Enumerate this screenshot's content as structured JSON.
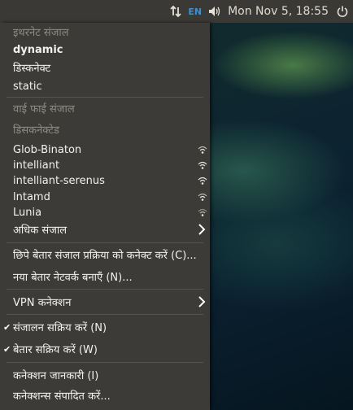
{
  "topbar": {
    "lang": "EN",
    "clock": "Mon Nov  5, 18:55"
  },
  "menu": {
    "ethernet_header": "इथरनेट संजाल",
    "ethernet_items": [
      "dynamic",
      "डिस्कनेक्ट",
      "static"
    ],
    "wifi_header": "वाई फाई  संजाल",
    "wifi_disconnected": "डिसकनेक्टेड",
    "networks": [
      "Glob-Binaton",
      "intelliant",
      "intelliant-serenus",
      "lntamd",
      "Lunia"
    ],
    "more_networks": "अधिक संजाल",
    "connect_hidden": "छिपे बेतार संजाल प्रक्रिया को कनेक्ट करें (C)...",
    "create_new": "नया बेतार नेटवर्क बनाएँ (N)...",
    "vpn": "VPN कनेक्शन",
    "enable_networking": "संजालन सक्रिय करें (N)",
    "enable_wifi": "बेतार सक्रिय करें (W)",
    "connection_info": "कनेक्शन जानकारी (I)",
    "edit_connections": "कनेक्शन्स संपादित करें..."
  },
  "icons": {
    "network": "network-transfer-icon",
    "volume": "volume-icon",
    "power": "power-icon",
    "wifi": "wifi-signal-icon",
    "submenu": "chevron-right-icon",
    "check": "check-icon"
  },
  "colors": {
    "panel": "#3a3935",
    "menu_bg": "#3c3b37",
    "header_text": "#8e8b84",
    "lang_accent": "#3f8fd0"
  }
}
